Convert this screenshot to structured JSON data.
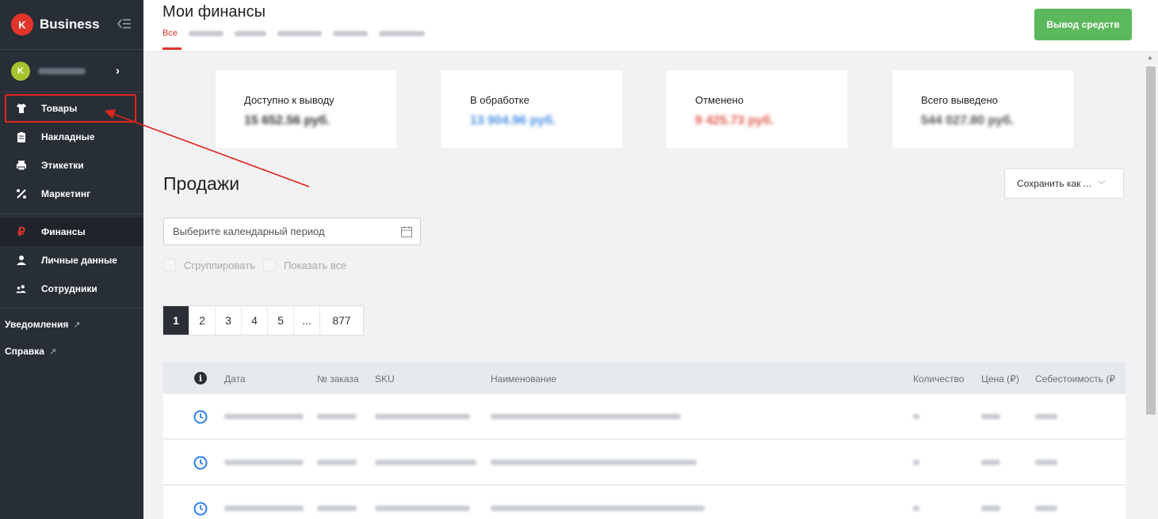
{
  "sidebar": {
    "logo_badge": "K",
    "brand": "Business",
    "account_initial": "K",
    "items": [
      {
        "label": "Товары",
        "icon": "shirt-icon"
      },
      {
        "label": "Накладные",
        "icon": "clipboard-icon"
      },
      {
        "label": "Этикетки",
        "icon": "printer-icon"
      },
      {
        "label": "Маркетинг",
        "icon": "percent-icon"
      },
      {
        "label": "Финансы",
        "icon": "ruble-icon"
      },
      {
        "label": "Личные данные",
        "icon": "person-icon"
      },
      {
        "label": "Сотрудники",
        "icon": "people-icon"
      }
    ],
    "links": [
      {
        "label": "Уведомления",
        "arrow": "↗"
      },
      {
        "label": "Справка",
        "arrow": "↗"
      }
    ]
  },
  "header": {
    "title": "Мои финансы",
    "active_tab": "Все",
    "withdraw_button": "Вывод средств"
  },
  "cards": [
    {
      "label": "Доступно к выводу",
      "value": "15 652.56 руб.",
      "color": "#333333"
    },
    {
      "label": "В обработке",
      "value": "13 904.96 руб.",
      "color": "#4a90e2"
    },
    {
      "label": "Отменено",
      "value": "9 425.73 руб.",
      "color": "#e05a4e"
    },
    {
      "label": "Всего выведено",
      "value": "544 027.80 руб.",
      "color": "#555555"
    }
  ],
  "sales": {
    "title": "Продажи",
    "save_as": "Сохранить как ...",
    "period_placeholder": "Выберите календарный период",
    "group_label": "Сгруппировать",
    "show_all_label": "Показать все",
    "pages": [
      "1",
      "2",
      "3",
      "4",
      "5",
      "...",
      "877"
    ]
  },
  "table": {
    "columns": [
      "Дата",
      "№ заказа",
      "SKU",
      "Наименование",
      "Количество",
      "Цена (₽)",
      "Себестоимость (₽"
    ]
  },
  "colors": {
    "accent_red": "#e3352b",
    "sidebar_bg": "#282e36",
    "button_green": "#5cb85c",
    "clock_blue": "#2f80ed"
  }
}
